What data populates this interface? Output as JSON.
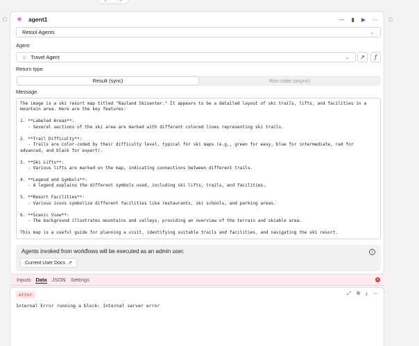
{
  "header": {
    "title": "agent1",
    "actions": [
      "—",
      "▮",
      "▶",
      "···"
    ]
  },
  "resource": {
    "value": "Retool Agents"
  },
  "agent": {
    "label": "Agent",
    "value": "Travel Agent"
  },
  "return_type": {
    "label": "Return type",
    "options": [
      "Result (sync)",
      "Run state (async)"
    ],
    "selected": "Result (sync)"
  },
  "message": {
    "label": "Message",
    "text": "The image is a ski resort map titled \"Rauland Skisenter.\" It appears to be a detailed layout of ski trails, lifts, and facilities in a mountain area. Here are the key features:\n\n1. **Labeled Areas**:\n   - Several sections of the ski area are marked with different colored lines representing ski trails.\n\n2. **Trail Difficulty**:\n   - Trails are color-coded by their difficulty level, typical for ski maps (e.g., green for easy, blue for intermediate, red for advanced, and black for expert).\n\n3. **Ski Lifts**:\n   - Various lifts are marked on the map, indicating connections between different trails.\n\n4. **Legend and Symbols**:\n   - A legend explains the different symbols used, including ski lifts, trails, and facilities.\n\n5. **Resort Facilities**:\n   - Various icons symbolize different facilities like restaurants, ski schools, and parking areas.\n\n6. **Scenic View**:\n   - The background illustrates mountains and valleys, providing an overview of the terrain and skiable area.\n\nThis map is a useful guide for planning a visit, identifying suitable trails and facilities, and navigating the ski resort."
  },
  "notice": {
    "text": "Agents invoked from workflows will be executed as an admin user.",
    "button": "Current User Docs"
  },
  "output_tabs": [
    "Inputs",
    "Data",
    "JSON",
    "Settings"
  ],
  "output_tabs_active": "Data",
  "output": {
    "badge": "error",
    "error_text": "Internal Error running a block: Internal server error"
  },
  "colors": {
    "accent": "#3a5cf0",
    "error": "#d8303a",
    "agent_logo": "#d94cc0"
  }
}
